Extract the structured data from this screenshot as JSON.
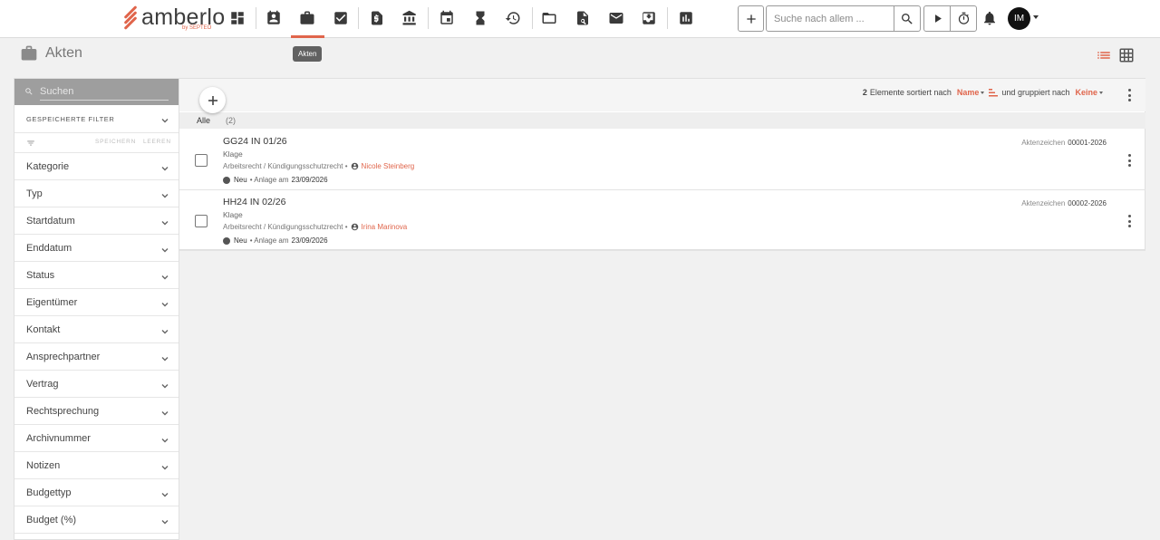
{
  "app": {
    "logo_word": "amberlo",
    "logo_sub": "by SEPTEO",
    "brand_color": "#e0654b"
  },
  "topnav": {
    "items": [
      {
        "name": "dashboard-icon"
      },
      {
        "name": "contacts-icon"
      },
      {
        "name": "briefcase-icon"
      },
      {
        "name": "tasks-icon"
      },
      {
        "name": "billing-icon"
      },
      {
        "name": "bank-icon"
      },
      {
        "name": "calendar-icon"
      },
      {
        "name": "hourglass-icon"
      },
      {
        "name": "history-icon"
      },
      {
        "name": "folder-icon"
      },
      {
        "name": "folder-search-icon"
      },
      {
        "name": "mail-icon"
      },
      {
        "name": "inbox-icon"
      },
      {
        "name": "reports-icon"
      }
    ],
    "active_tooltip": "Akten",
    "search_placeholder": "Suche nach allem ...",
    "avatar_initials": "IM"
  },
  "page": {
    "title": "Akten"
  },
  "sidebar": {
    "search_placeholder": "Suchen",
    "saved_filters_label": "GESPEICHERTE FILTER",
    "save_label": "SPEICHERN",
    "clear_label": "LEEREN",
    "filters": [
      "Kategorie",
      "Typ",
      "Startdatum",
      "Enddatum",
      "Status",
      "Eigentümer",
      "Kontakt",
      "Ansprechpartner",
      "Vertrag",
      "Rechtsprechung",
      "Archivnummer",
      "Notizen",
      "Budgettyp",
      "Budget (%)"
    ]
  },
  "list": {
    "count": "2",
    "count_suffix": "Elemente sortiert nach",
    "sort_by": "Name",
    "group_text": "und gruppiert nach",
    "group_by": "Keine",
    "group_label": "Alle",
    "group_count": "(2)",
    "items": [
      {
        "title": "GG24 IN 01/26",
        "type": "Klage",
        "area": "Arbeitsrecht / Kündigungsschutzrecht •",
        "person": "Nicole Steinberg",
        "status": "Neu",
        "created_prefix": "• Anlage am",
        "created_date": "23/09/2026",
        "ref_label": "Aktenzeichen",
        "ref_value": "00001-2026"
      },
      {
        "title": "HH24 IN 02/26",
        "type": "Klage",
        "area": "Arbeitsrecht / Kündigungsschutzrecht •",
        "person": "Irina Marinova",
        "status": "Neu",
        "created_prefix": "• Anlage am",
        "created_date": "23/09/2026",
        "ref_label": "Aktenzeichen",
        "ref_value": "00002-2026"
      }
    ]
  }
}
